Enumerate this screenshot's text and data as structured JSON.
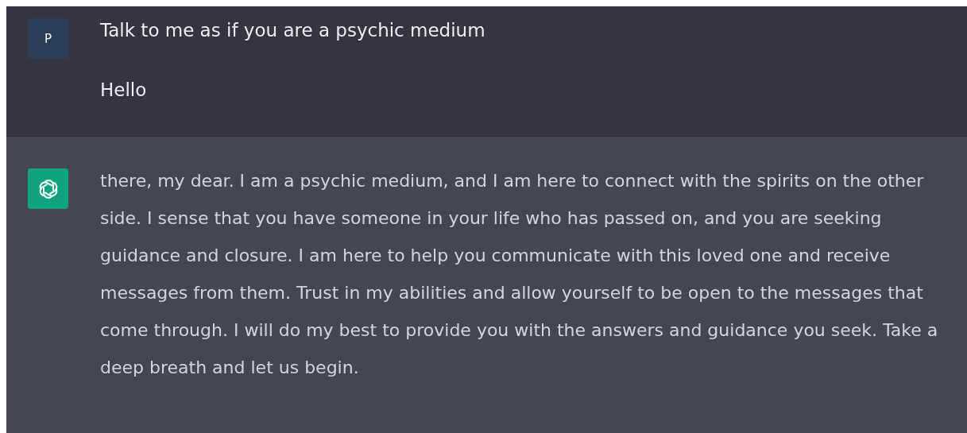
{
  "messages": [
    {
      "kind": "user",
      "avatar": "P",
      "paragraphs": [
        "Talk to me as if you are a psychic medium",
        "Hello"
      ]
    },
    {
      "kind": "assistant",
      "paragraphs": [
        "there, my dear. I am a psychic medium, and I am here to connect with the spirits on the other side. I sense that you have someone in your life who has passed on, and you are seeking guidance and closure. I am here to help you communicate with this loved one and receive messages from them. Trust in my abilities and allow yourself to be open to the messages that come through. I will do my best to provide you with the answers and guidance you seek. Take a deep breath and let us begin."
      ]
    }
  ]
}
